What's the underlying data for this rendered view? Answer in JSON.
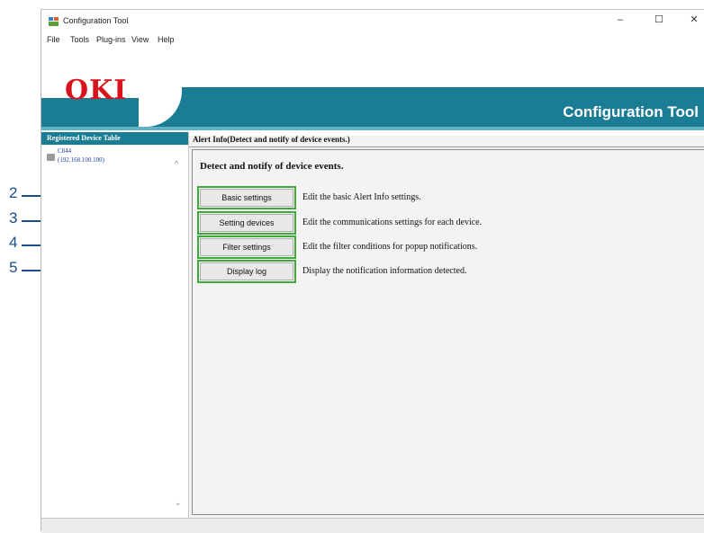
{
  "window": {
    "title": "Configuration Tool",
    "controls": {
      "minimize": "–",
      "maximize": "☐",
      "close": "✕"
    }
  },
  "menubar": {
    "items": [
      {
        "label": "File"
      },
      {
        "label": "Tools"
      },
      {
        "label": "Plug-ins"
      },
      {
        "label": "View"
      },
      {
        "label": "Help"
      }
    ]
  },
  "banner": {
    "logo": "OKI",
    "title": "Configuration Tool",
    "colors": {
      "brand_red": "#d8131b",
      "teal": "#1b7d93"
    }
  },
  "left_panel": {
    "header": "Registered Device Table",
    "device": {
      "name": "C844",
      "ip": "(192.168.100.100)",
      "icon": "printer-icon"
    }
  },
  "main": {
    "header": "Alert Info(Detect and notify of device events.)",
    "section_title": "Detect and notify of device events.",
    "actions": [
      {
        "callout": "2",
        "button": "Basic settings",
        "description": "Edit the basic Alert Info settings."
      },
      {
        "callout": "3",
        "button": "Setting devices",
        "description": "Edit the communications settings for each device."
      },
      {
        "callout": "4",
        "button": "Filter settings",
        "description": "Edit the filter conditions for popup notifications."
      },
      {
        "callout": "5",
        "button": "Display log",
        "description": "Display the notification information detected."
      }
    ]
  },
  "annotation_colors": {
    "highlight": "#3eaa3e",
    "callout": "#1b4d8a"
  }
}
